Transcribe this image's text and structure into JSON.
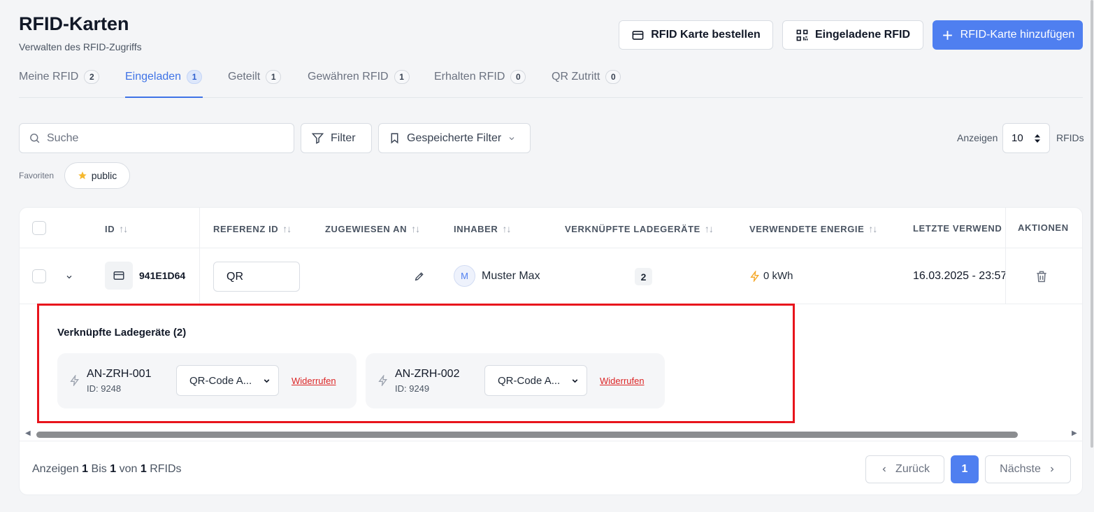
{
  "header": {
    "title": "RFID-Karten",
    "subtitle": "Verwalten des RFID-Zugriffs",
    "btn_order": "RFID Karte bestellen",
    "btn_invited": "Eingeladene RFID",
    "btn_add": "RFID-Karte hinzufügen"
  },
  "tabs": [
    {
      "label": "Meine RFID",
      "count": "2"
    },
    {
      "label": "Eingeladen",
      "count": "1",
      "active": true
    },
    {
      "label": "Geteilt",
      "count": "1"
    },
    {
      "label": "Gewähren RFID",
      "count": "1"
    },
    {
      "label": "Erhalten RFID",
      "count": "0"
    },
    {
      "label": "QR Zutritt",
      "count": "0"
    }
  ],
  "toolbar": {
    "search_placeholder": "Suche",
    "filter_label": "Filter",
    "saved_filter_label": "Gespeicherte Filter",
    "show_label": "Anzeigen",
    "per_page": "10",
    "per_page_unit": "RFIDs",
    "favorites_label": "Favoriten",
    "favorite_chip": "public"
  },
  "table": {
    "columns": {
      "id": "ID",
      "reference": "REFERENZ ID",
      "assigned": "ZUGEWIESEN AN",
      "owner": "INHABER",
      "linked": "VERKNÜPFTE LADEGERÄTE",
      "energy": "VERWENDETE ENERGIE",
      "last_used": "LETZTE VERWEND",
      "actions": "AKTIONEN"
    },
    "row": {
      "id": "941E1D64",
      "reference": "QR",
      "owner_initial": "M",
      "owner": "Muster Max",
      "linked_count": "2",
      "energy": "0 kWh",
      "last_used": "16.03.2025 - 23:57"
    },
    "expanded": {
      "title": "Verknüpfte Ladegeräte (2)",
      "chargers": [
        {
          "name": "AN-ZRH-001",
          "id": "ID: 9248",
          "select": "QR-Code A...",
          "revoke": "Widerrufen"
        },
        {
          "name": "AN-ZRH-002",
          "id": "ID: 9249",
          "select": "QR-Code A...",
          "revoke": "Widerrufen"
        }
      ]
    }
  },
  "footer": {
    "t1": "Anzeigen",
    "from": "1",
    "t2": "Bis",
    "to": "1",
    "t3": "von",
    "total": "1",
    "t4": "RFIDs",
    "prev": "Zurück",
    "page": "1",
    "next": "Nächste"
  },
  "colors": {
    "accent": "#4f7ff0",
    "highlight": "#e8141c",
    "energy": "#f5a623",
    "revoke": "#dc2626"
  },
  "icons": {
    "order": "credit-card-icon",
    "invited": "qr-code-icon",
    "add": "plus-icon",
    "search": "search-icon",
    "filter": "funnel-icon",
    "saved_filter": "bookmark-icon",
    "favorite": "star-icon",
    "card": "credit-card-icon",
    "edit": "pencil-icon",
    "energy": "bolt-icon",
    "delete": "trash-icon"
  }
}
